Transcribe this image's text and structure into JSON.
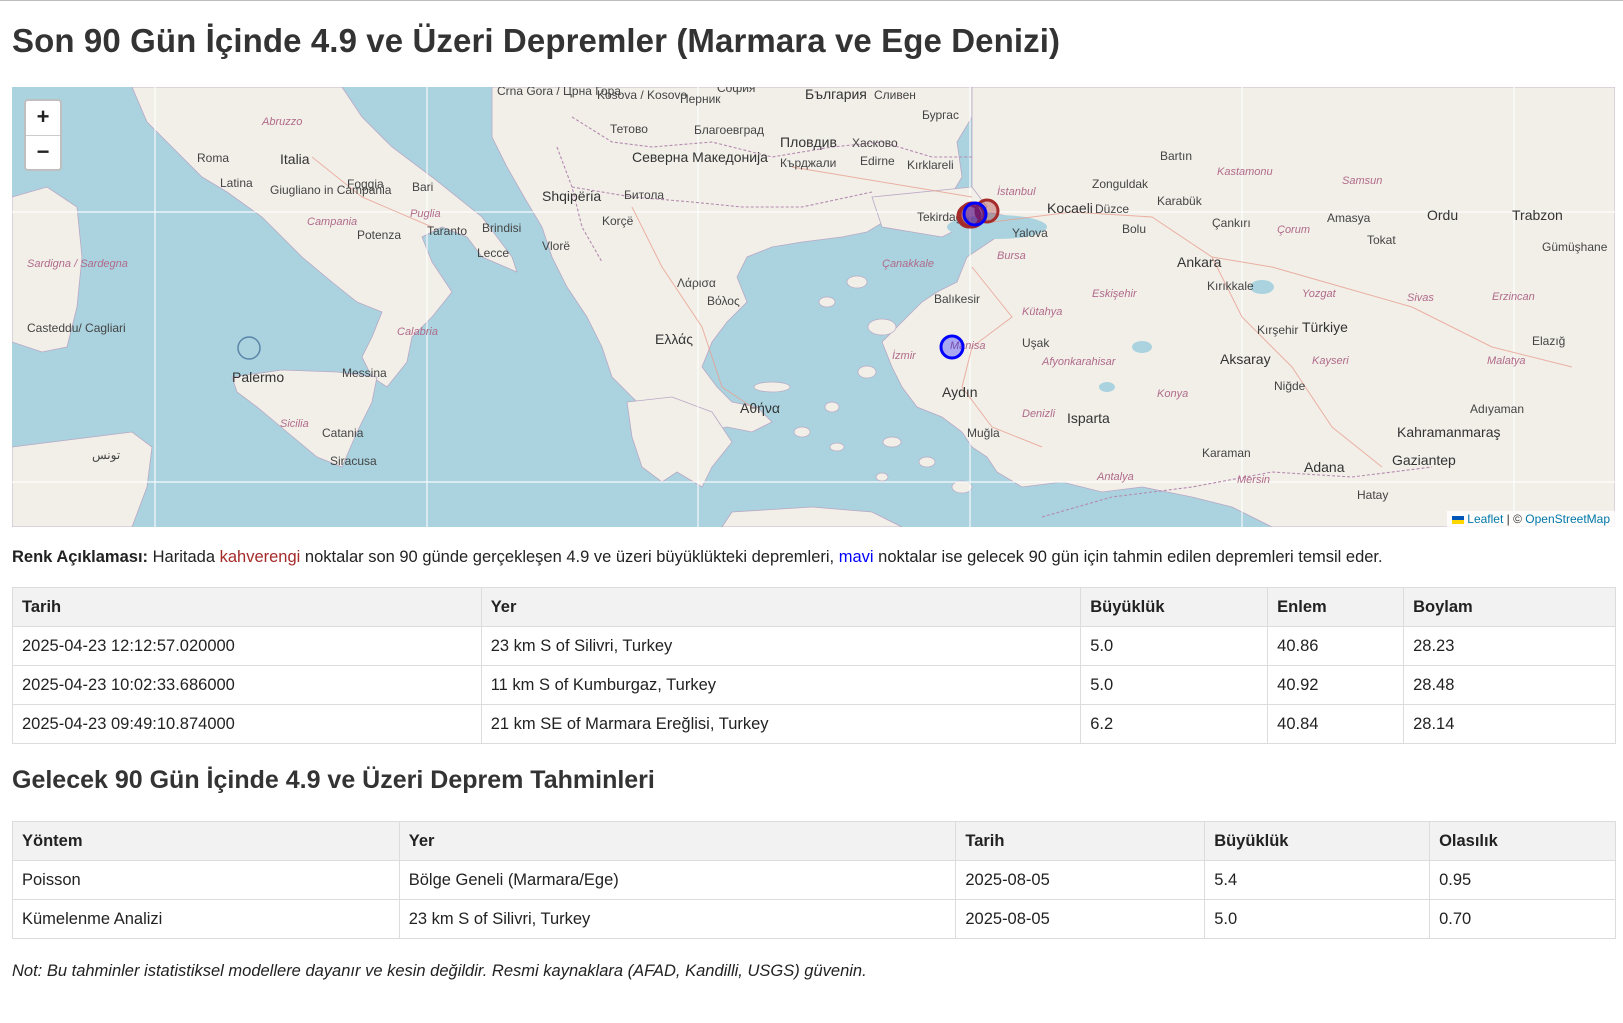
{
  "title": "Son 90 Gün İçinde 4.9 ve Üzeri Depremler (Marmara ve Ege Denizi)",
  "map": {
    "zoom_in": "+",
    "zoom_out": "−",
    "attribution_leaflet": "Leaflet",
    "attribution_sep": " | © ",
    "attribution_osm": "OpenStreetMap",
    "labels": {
      "roma": "Roma",
      "italia": "Italia",
      "napoli": "Giugliano in Campania",
      "bari": "Bari",
      "foggia": "Foggia",
      "taranto": "Taranto",
      "brindisi": "Brindisi",
      "lecce": "Lecce",
      "potenza": "Potenza",
      "latina": "Latina",
      "sardegna": "Sardigna / Sardegna",
      "cagliari": "Casteddu/ Cagliari",
      "palermo": "Palermo",
      "messina": "Messina",
      "sicilia": "Sicilia",
      "catania": "Catania",
      "siracusa": "Siracusa",
      "tunis": "تونس",
      "sofia": "София",
      "bulgaria": "България",
      "plovdiv": "Пловдив",
      "edirne": "Edirne",
      "kirklareli": "Kırklareli",
      "makedonija": "Северна Македонија",
      "kosovo": "Kosova / Kosovo",
      "shqiperia": "Shqipëria",
      "korce": "Korçë",
      "vlore": "Vlorë",
      "ellas": "Ελλάς",
      "athina": "Αθήνα",
      "larisa": "Λάρισα",
      "volos": "Βόλος",
      "istanbul": "İstanbul",
      "tekirdag": "Tekirdağ",
      "kocaeli": "Kocaeli",
      "yalova": "Yalova",
      "bursa": "Bursa",
      "canakkale": "Çanakkale",
      "balikesir": "Balıkesir",
      "izmir": "İzmir",
      "manisa": "Manisa",
      "usak": "Uşak",
      "aydin": "Aydın",
      "mugla": "Muğla",
      "denizli": "Denizli",
      "isparta": "Isparta",
      "antalya": "Antalya",
      "ankara": "Ankara",
      "turkiye": "Türkiye",
      "kirikkale": "Kırıkkale",
      "aksaray": "Aksaray",
      "nigde": "Niğde",
      "kayseri": "Kayseri",
      "konya": "Konya",
      "karaman": "Karaman",
      "adana": "Adana",
      "mersin": "Mersin",
      "hatay": "Hatay",
      "gaziantep": "Gaziantep",
      "kahramanmaras": "Kahramanmaraş",
      "adiyaman": "Adıyaman",
      "malatya": "Malatya",
      "elazig": "Elazığ",
      "sivas": "Sivas",
      "tokat": "Tokat",
      "amasya": "Amasya",
      "samsun": "Samsun",
      "ordu": "Ordu",
      "trabzon": "Trabzon",
      "corum": "Çorum",
      "cankiri": "Çankırı",
      "karabuk": "Karabük",
      "kastamonu": "Kastamonu",
      "bartin": "Bartın",
      "zonguldak": "Zonguldak",
      "duzce": "Düzce",
      "bolu": "Bolu",
      "eskisehir": "Eskişehir",
      "kutahya": "Kütahya",
      "afyon": "Afyonkarahisar",
      "yozgat": "Yozgat",
      "kirsehir": "Kırşehir",
      "erzincan": "Erzincan",
      "gumushane": "Gümüşhane",
      "sliven": "Сливен",
      "burgas": "Бургас",
      "haskovo": "Хасково",
      "kardzhali": "Кърджали",
      "pernik": "Перник",
      "blagoevgrad": "Благоевград",
      "tetovo": "Тетово",
      "bitola": "Битола",
      "crnagora": "Crna Gora / Црна Гора",
      "abruzzo": "Abruzzo",
      "campania": "Campania",
      "puglia": "Puglia",
      "calabria": "Calabria"
    }
  },
  "legend": {
    "lead": "Renk Açıklaması:",
    "part1": " Haritada ",
    "brown": "kahverengi",
    "part2": " noktalar son 90 günde gerçekleşen 4.9 ve üzeri büyüklükteki depremleri, ",
    "blue": "mavi",
    "part3": " noktalar ise gelecek 90 gün için tahmin edilen depremleri temsil eder."
  },
  "recent_table": {
    "headers": [
      "Tarih",
      "Yer",
      "Büyüklük",
      "Enlem",
      "Boylam"
    ],
    "rows": [
      [
        "2025-04-23 12:12:57.020000",
        "23 km S of Silivri, Turkey",
        "5.0",
        "40.86",
        "28.23"
      ],
      [
        "2025-04-23 10:02:33.686000",
        "11 km S of Kumburgaz, Turkey",
        "5.0",
        "40.92",
        "28.48"
      ],
      [
        "2025-04-23 09:49:10.874000",
        "21 km SE of Marmara Ereğlisi, Turkey",
        "6.2",
        "40.84",
        "28.14"
      ]
    ]
  },
  "forecast_title": "Gelecek 90 Gün İçinde 4.9 ve Üzeri Deprem Tahminleri",
  "forecast_table": {
    "headers": [
      "Yöntem",
      "Yer",
      "Tarih",
      "Büyüklük",
      "Olasılık"
    ],
    "rows": [
      [
        "Poisson",
        "Bölge Geneli (Marmara/Ege)",
        "2025-08-05",
        "5.4",
        "0.95"
      ],
      [
        "Kümelenme Analizi",
        "23 km S of Silivri, Turkey",
        "2025-08-05",
        "5.0",
        "0.70"
      ]
    ]
  },
  "note": "Not: Bu tahminler istatistiksel modellere dayanır ve kesin değildir. Resmi kaynaklara (AFAD, Kandilli, USGS) güvenin.",
  "colors": {
    "sea": "#aad3df",
    "land": "#f2efe9",
    "recent_marker": "#a52a2a",
    "forecast_marker": "#0000ff"
  }
}
